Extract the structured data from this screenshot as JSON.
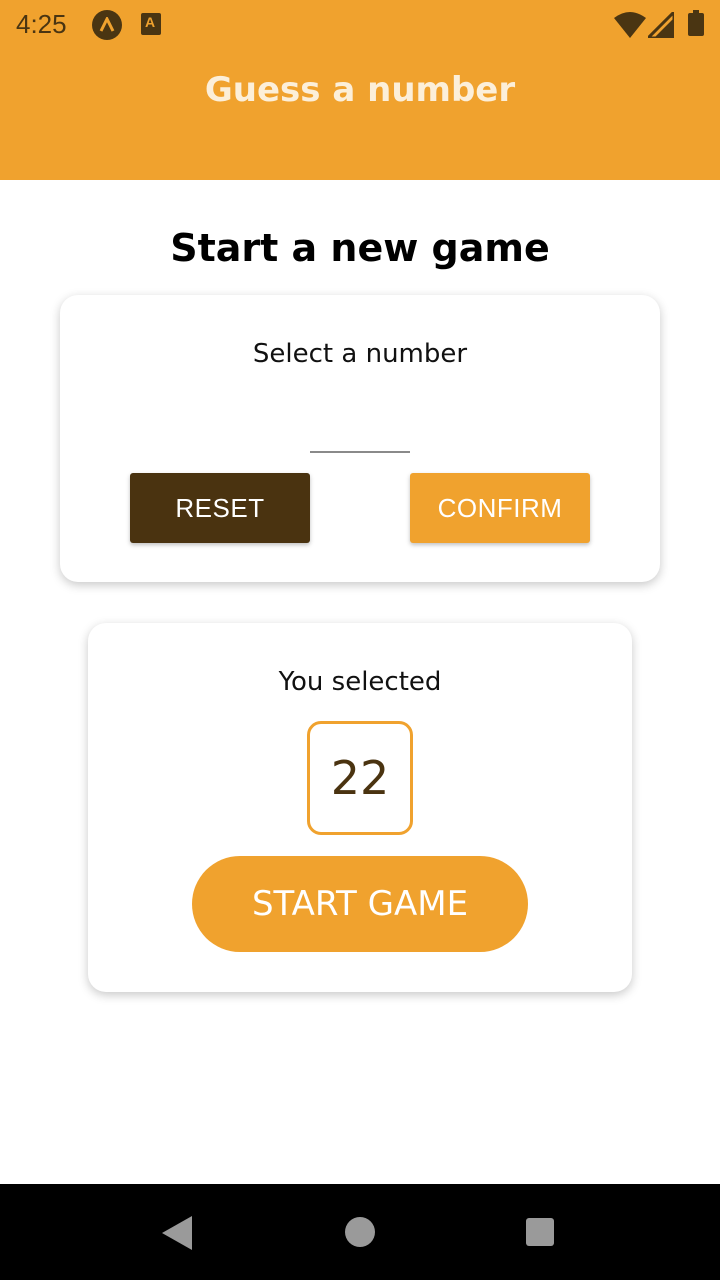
{
  "status_bar": {
    "time": "4:25",
    "icons": [
      "app-a-icon",
      "a-badge-icon",
      "wifi-icon",
      "signal-icon",
      "battery-icon"
    ],
    "badge_letter": "A"
  },
  "header": {
    "title": "Guess a number",
    "background_color": "#f0a22e"
  },
  "main": {
    "page_title": "Start a new game",
    "input_card": {
      "label": "Select a number",
      "input_value": "",
      "reset_label": "RESET",
      "confirm_label": "CONFIRM"
    },
    "selected_card": {
      "label": "You selected",
      "selected_number": "22",
      "start_label": "START GAME"
    }
  },
  "nav_bar": {
    "buttons": [
      "back-icon",
      "home-icon",
      "recent-apps-icon"
    ]
  },
  "colors": {
    "accent": "#f0a22e",
    "dark_brown": "#4a3310"
  }
}
